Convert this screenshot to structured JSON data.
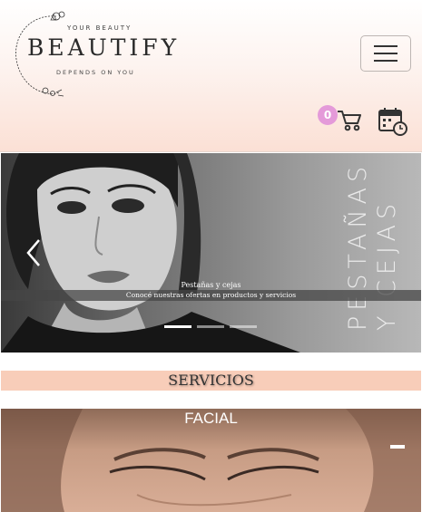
{
  "header": {
    "brand": "BEAUTIFY",
    "tagline_top": "YOUR BEAUTY",
    "tagline_bottom": "DEPENDS ON YOU",
    "menu_icon": "hamburger-icon",
    "cart": {
      "count": "0",
      "icon": "shopping-cart-icon",
      "badge_color": "#e49ad9"
    },
    "calendar_icon": "calendar-clock-icon"
  },
  "carousel": {
    "vertical_line1": "PESTAÑAS",
    "vertical_line2": "Y CEJAS",
    "caption_title": "Pestañas y cejas",
    "caption_text": "Conocé nuestras ofertas en productos y servicios",
    "prev_icon": "chevron-left-icon",
    "indicators": 3,
    "active_indicator": 0
  },
  "servicios": {
    "label": "SERVICIOS",
    "bg": "#f8cdb9"
  },
  "facial": {
    "title": "FACIAL",
    "next_icon": "dash-icon"
  },
  "colors": {
    "header_gradient_end": "#fbe0d5",
    "accent": "#e49ad9"
  }
}
